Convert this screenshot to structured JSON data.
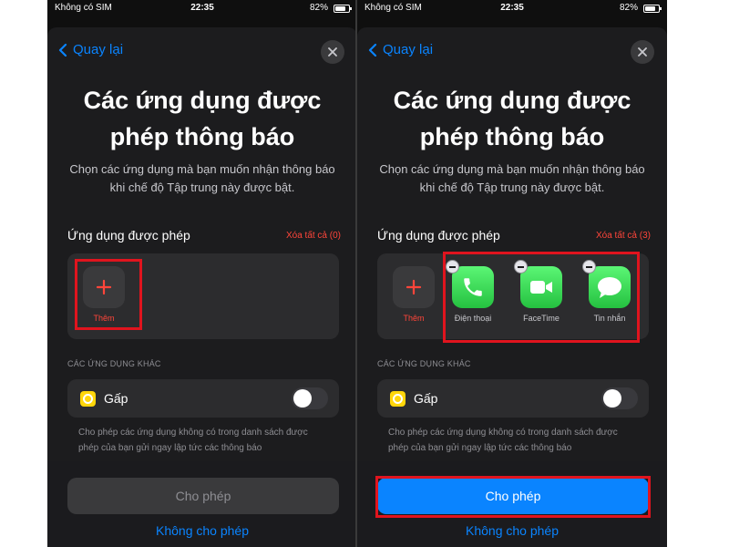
{
  "status_bar": {
    "carrier": "Không có SIM",
    "time": "22:35",
    "battery": "82%",
    "battery_level": 0.82
  },
  "nav": {
    "back_label": "Quay lại"
  },
  "page": {
    "title": "Các ứng dụng được phép thông báo",
    "subtitle": "Chọn các ứng dụng mà bạn muốn nhận thông báo khi chế độ Tập trung này được bật."
  },
  "allowed_section": {
    "label": "Ứng dụng được phép"
  },
  "left": {
    "clear_all": "Xóa tất cả (0)",
    "add_label": "Thêm",
    "primary_button": "Cho phép",
    "primary_enabled": false,
    "secondary_button": "Không cho phép"
  },
  "right": {
    "clear_all": "Xóa tất cả (3)",
    "add_label": "Thêm",
    "apps": [
      {
        "name": "Điện thoại",
        "icon": "phone-icon"
      },
      {
        "name": "FaceTime",
        "icon": "facetime-icon"
      },
      {
        "name": "Tin nhắn",
        "icon": "messages-icon"
      }
    ],
    "primary_button": "Cho phép",
    "primary_enabled": true,
    "secondary_button": "Không cho phép"
  },
  "other_apps": {
    "label": "CÁC ỨNG DỤNG KHÁC",
    "urgent_label": "Gấp",
    "urgent_toggle_on": false,
    "footnote": "Cho phép các ứng dụng không có trong danh sách được phép của bạn gửi ngay lập tức các thông báo"
  },
  "colors": {
    "accent": "#0a84ff",
    "destructive": "#ff453a",
    "highlight": "#e0141e",
    "app_green": "#25c140"
  }
}
